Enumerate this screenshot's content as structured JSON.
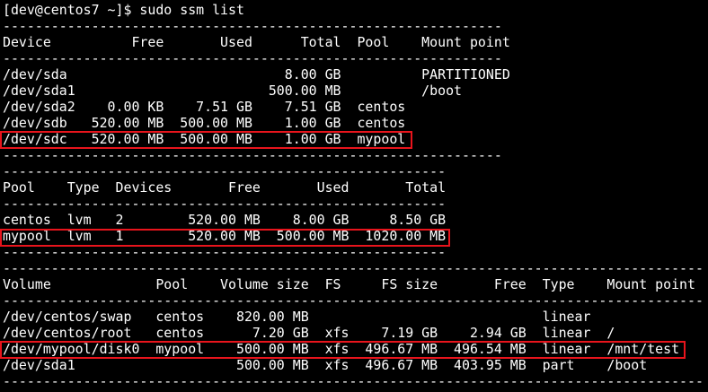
{
  "colors": {
    "background": "#000000",
    "text": "#ffffff",
    "highlight": "#e8141c"
  },
  "prompt": "[dev@centos7 ~]$ sudo ssm list",
  "devices": {
    "rule": "--------------------------------------------------------------",
    "header": "Device          Free       Used      Total  Pool    Mount point",
    "rows": [
      "/dev/sda                           8.00 GB          PARTITIONED",
      "/dev/sda1                        500.00 MB          /boot",
      "/dev/sda2    0.00 KB    7.51 GB    7.51 GB  centos",
      "/dev/sdb   520.00 MB  500.00 MB    1.00 GB  centos",
      "/dev/sdc   520.00 MB  500.00 MB    1.00 GB  mypool"
    ]
  },
  "pools": {
    "rule": "-------------------------------------------------------",
    "header": "Pool    Type  Devices       Free       Used       Total",
    "rows": [
      "centos  lvm   2        520.00 MB    8.00 GB     8.50 GB",
      "mypool  lvm   1        520.00 MB  500.00 MB  1020.00 MB"
    ]
  },
  "volumes": {
    "rule": "---------------------------------------------------------------------------------------",
    "header": "Volume             Pool    Volume size  FS     FS size       Free  Type    Mount point",
    "rows": [
      "/dev/centos/swap   centos    820.00 MB                             linear",
      "/dev/centos/root   centos      7.20 GB  xfs    7.19 GB    2.94 GB  linear  /",
      "/dev/mypool/disk0  mypool    500.00 MB  xfs  496.67 MB  496.54 MB  linear  /mnt/test",
      "/dev/sda1                    500.00 MB  xfs  496.67 MB  403.95 MB  part    /boot"
    ]
  }
}
